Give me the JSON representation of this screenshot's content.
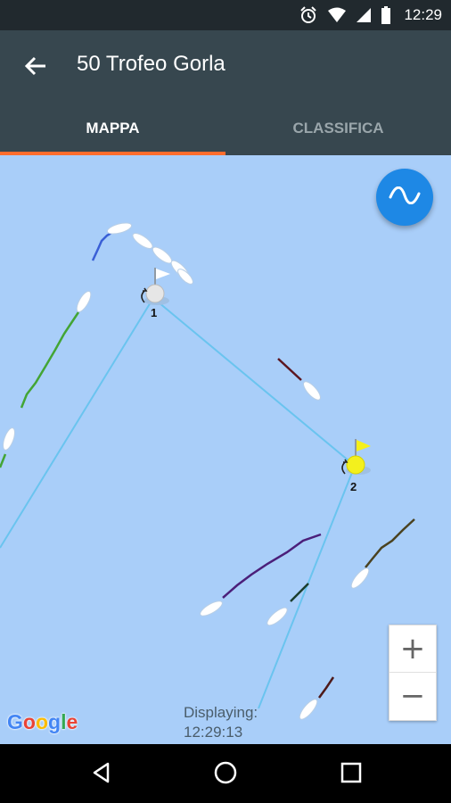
{
  "status": {
    "time": "12:29"
  },
  "appbar": {
    "title": "50 Trofeo Gorla"
  },
  "tabs": [
    {
      "label": "MAPPA",
      "active": true
    },
    {
      "label": "CLASSIFICA",
      "active": false
    }
  ],
  "map": {
    "marks": [
      {
        "label": "1",
        "flag_color": "#ffffff"
      },
      {
        "label": "2",
        "flag_color": "#f5f01b"
      }
    ],
    "course_color": "#6ac4ef",
    "displaying_label": "Displaying:",
    "displaying_time": "12:29:13",
    "attribution": "Google",
    "zoom_in": "+",
    "zoom_out": "−"
  },
  "colors": {
    "accent": "#ff6d2d",
    "appbar": "#37474f",
    "water": "#a9cef9",
    "fab": "#1e88e5"
  }
}
